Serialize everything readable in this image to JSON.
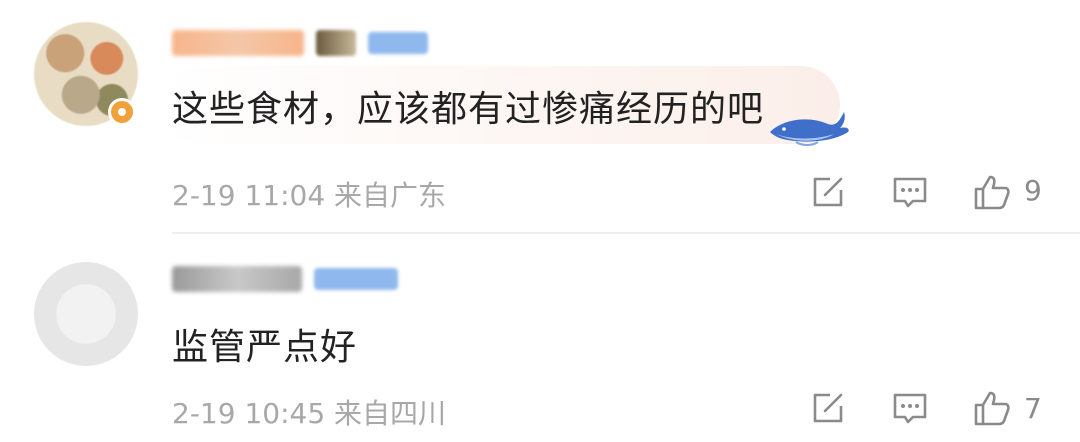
{
  "comments": [
    {
      "text": "这些食材，应该都有过惨痛经历的吧",
      "meta": "2-19 11:04 来自广东",
      "likes": "9",
      "bubble": "whale"
    },
    {
      "text": "监管严点好",
      "meta": "2-19 10:45 来自四川",
      "likes": "7"
    }
  ],
  "colors": {
    "text": "#222222",
    "meta": "#a8a8a8",
    "icon": "#8a8a8a",
    "badge": "#8fb9ee",
    "avatar_badge": "#f0a13a"
  }
}
